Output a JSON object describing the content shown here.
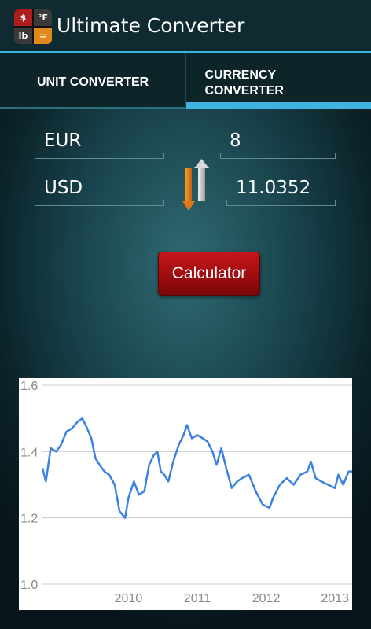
{
  "app": {
    "title": "Ultimate Converter",
    "icon": {
      "tl": "$",
      "tr": "°F",
      "bl": "lb",
      "br": "="
    }
  },
  "tabs": [
    {
      "label": "UNIT CONVERTER",
      "selected": false
    },
    {
      "label": "CURRENCY CONVERTER",
      "selected": true
    }
  ],
  "converter": {
    "from_currency": "EUR",
    "from_amount": "8",
    "to_currency": "USD",
    "to_amount": "11.0352",
    "swap_icon": "swap-arrows-icon"
  },
  "calculator_button": {
    "label": "Calculator"
  },
  "colors": {
    "accent": "#3fb3e0",
    "button": "#b01215",
    "chart_line": "#3b82e0"
  },
  "chart_data": {
    "type": "line",
    "title": "",
    "xlabel": "",
    "ylabel": "",
    "ylim": [
      1.0,
      1.6
    ],
    "xlim": [
      2009.25,
      2013.75
    ],
    "yticks": [
      "1.0",
      "1.2",
      "1.4",
      "1.6"
    ],
    "xticks": [
      "2010",
      "2011",
      "2012",
      "2013"
    ],
    "grid": true,
    "series": [
      {
        "x": [
          2009.25,
          2009.3,
          2009.37,
          2009.45,
          2009.52,
          2009.6,
          2009.68,
          2009.76,
          2009.83,
          2009.9,
          2009.96,
          2010.02,
          2010.08,
          2010.15,
          2010.22,
          2010.3,
          2010.37,
          2010.45,
          2010.5,
          2010.58,
          2010.65,
          2010.73,
          2010.8,
          2010.87,
          2010.92,
          2010.97,
          2011.02,
          2011.08,
          2011.15,
          2011.23,
          2011.3,
          2011.35,
          2011.42,
          2011.5,
          2011.58,
          2011.65,
          2011.72,
          2011.78,
          2011.85,
          2011.92,
          2012.0,
          2012.08,
          2012.15,
          2012.25,
          2012.35,
          2012.45,
          2012.55,
          2012.6,
          2012.7,
          2012.8,
          2012.9,
          2013.0,
          2013.1,
          2013.15,
          2013.22,
          2013.3,
          2013.4,
          2013.5,
          2013.55,
          2013.62,
          2013.7,
          2013.75
        ],
        "y": [
          1.35,
          1.31,
          1.41,
          1.4,
          1.42,
          1.46,
          1.47,
          1.49,
          1.5,
          1.47,
          1.44,
          1.38,
          1.36,
          1.34,
          1.33,
          1.3,
          1.22,
          1.2,
          1.26,
          1.31,
          1.27,
          1.28,
          1.36,
          1.39,
          1.4,
          1.34,
          1.33,
          1.31,
          1.37,
          1.42,
          1.45,
          1.48,
          1.44,
          1.45,
          1.44,
          1.43,
          1.4,
          1.36,
          1.41,
          1.35,
          1.29,
          1.31,
          1.32,
          1.33,
          1.28,
          1.24,
          1.23,
          1.26,
          1.3,
          1.32,
          1.3,
          1.33,
          1.34,
          1.37,
          1.32,
          1.31,
          1.3,
          1.29,
          1.33,
          1.3,
          1.34,
          1.34
        ]
      }
    ]
  }
}
